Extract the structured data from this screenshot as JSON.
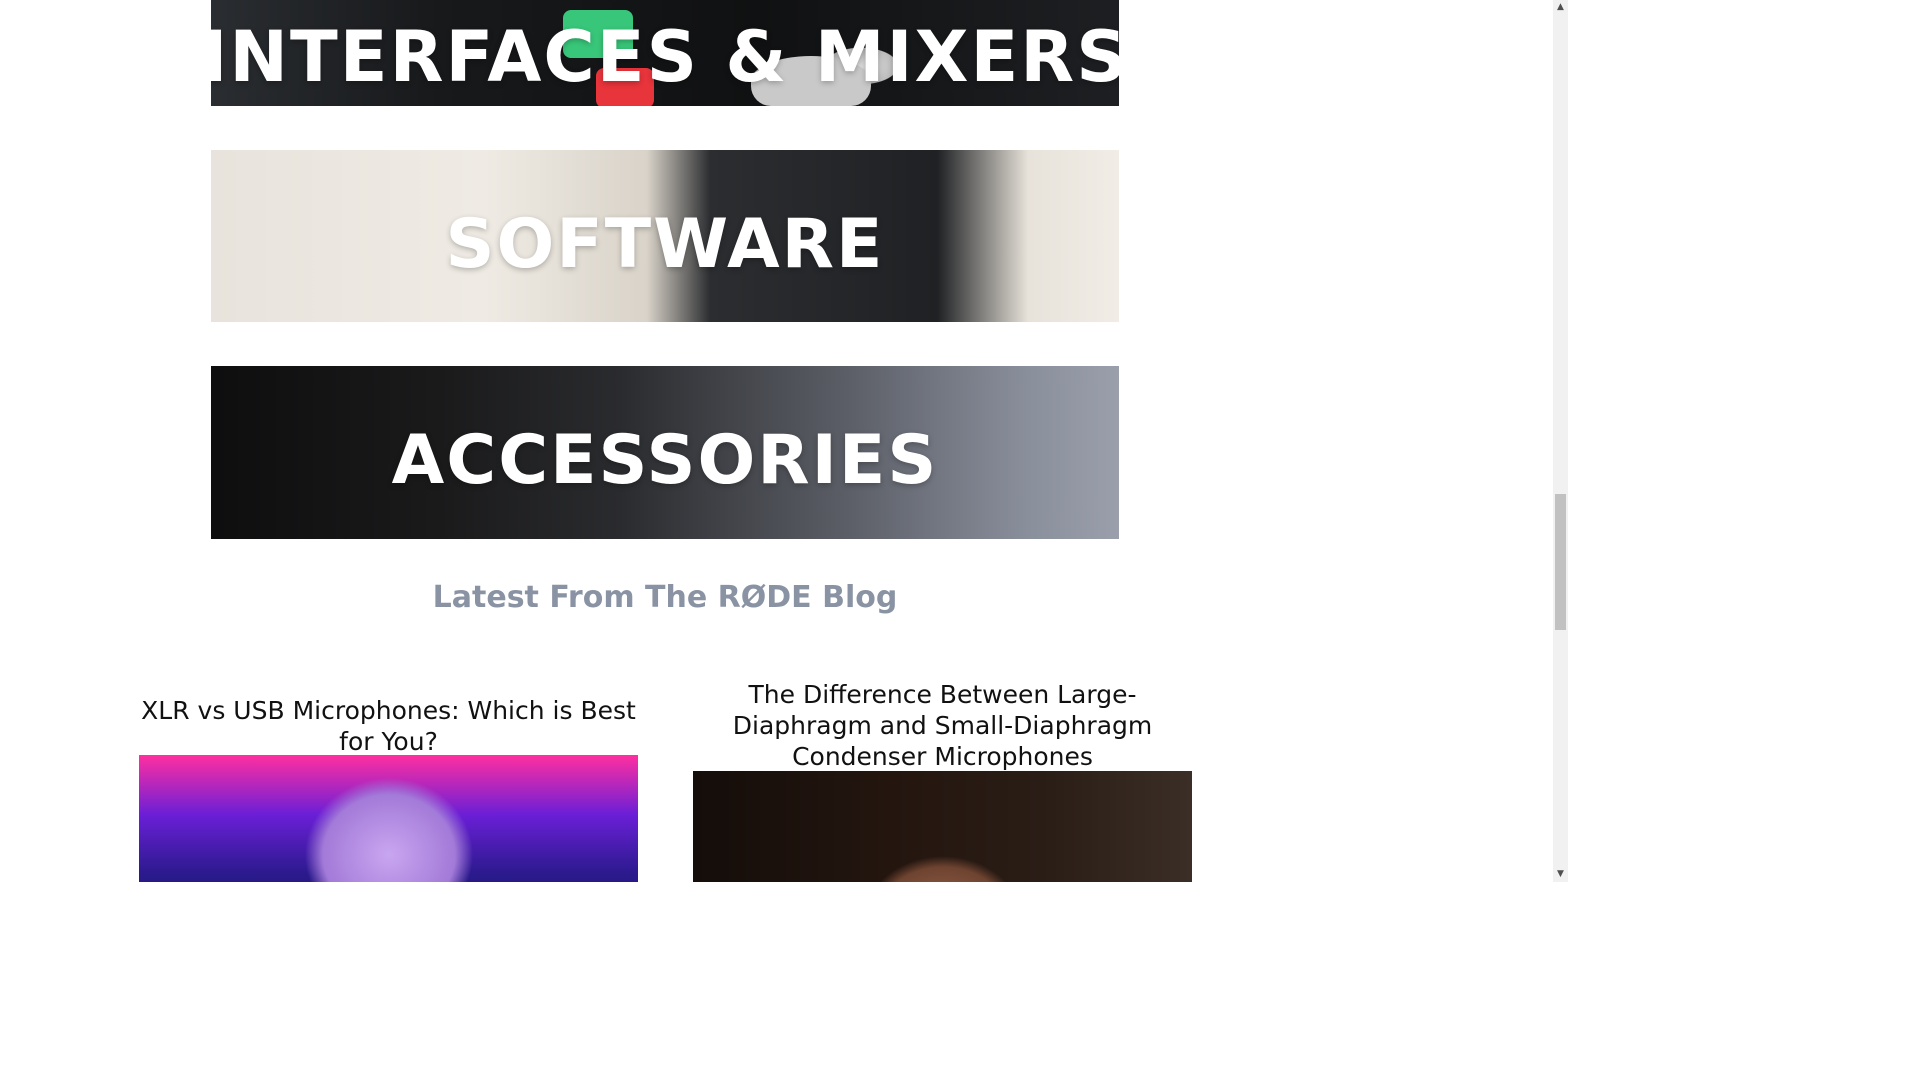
{
  "categories": [
    {
      "label": "INTERFACES & MIXERS"
    },
    {
      "label": "SOFTWARE"
    },
    {
      "label": "ACCESSORIES"
    }
  ],
  "blog": {
    "heading": "Latest From The RØDE Blog",
    "posts": [
      {
        "title": "XLR vs USB Microphones: Which is Best for You?"
      },
      {
        "title": "The Difference Between Large-Diaphragm and Small-Diaphragm Condenser Microphones"
      }
    ]
  },
  "scrollbar": {
    "up_icon": "▲",
    "down_icon": "▼"
  }
}
